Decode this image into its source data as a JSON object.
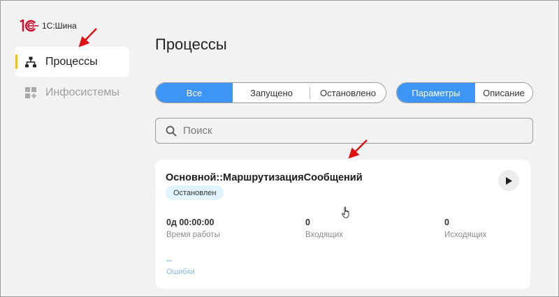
{
  "app": {
    "logo_text": "1С:Шина",
    "logo_mark": "1C"
  },
  "sidebar": {
    "items": [
      {
        "label": "Процессы",
        "icon": "hierarchy-icon",
        "active": true
      },
      {
        "label": "Инфосистемы",
        "icon": "grid-plus-icon",
        "active": false
      }
    ],
    "active_marker_color": "#f5c400"
  },
  "page": {
    "title": "Процессы"
  },
  "filters": {
    "state": [
      "Все",
      "Запущено",
      "Остановлено"
    ],
    "state_selected": "Все",
    "view": [
      "Параметры",
      "Описание"
    ],
    "view_selected": "Параметры",
    "accent_color": "#3d95f5"
  },
  "search": {
    "placeholder": "Поиск",
    "value": ""
  },
  "process": {
    "name": "Основной::МаршрутизацияСообщений",
    "status": "Остановлен",
    "stats": [
      {
        "value": "0д 00:00:00",
        "label": "Время работы"
      },
      {
        "value": "0",
        "label": "Входящих"
      },
      {
        "value": "0",
        "label": "Исходящих"
      }
    ],
    "errors": {
      "value": "--",
      "label": "Ошибки"
    }
  }
}
